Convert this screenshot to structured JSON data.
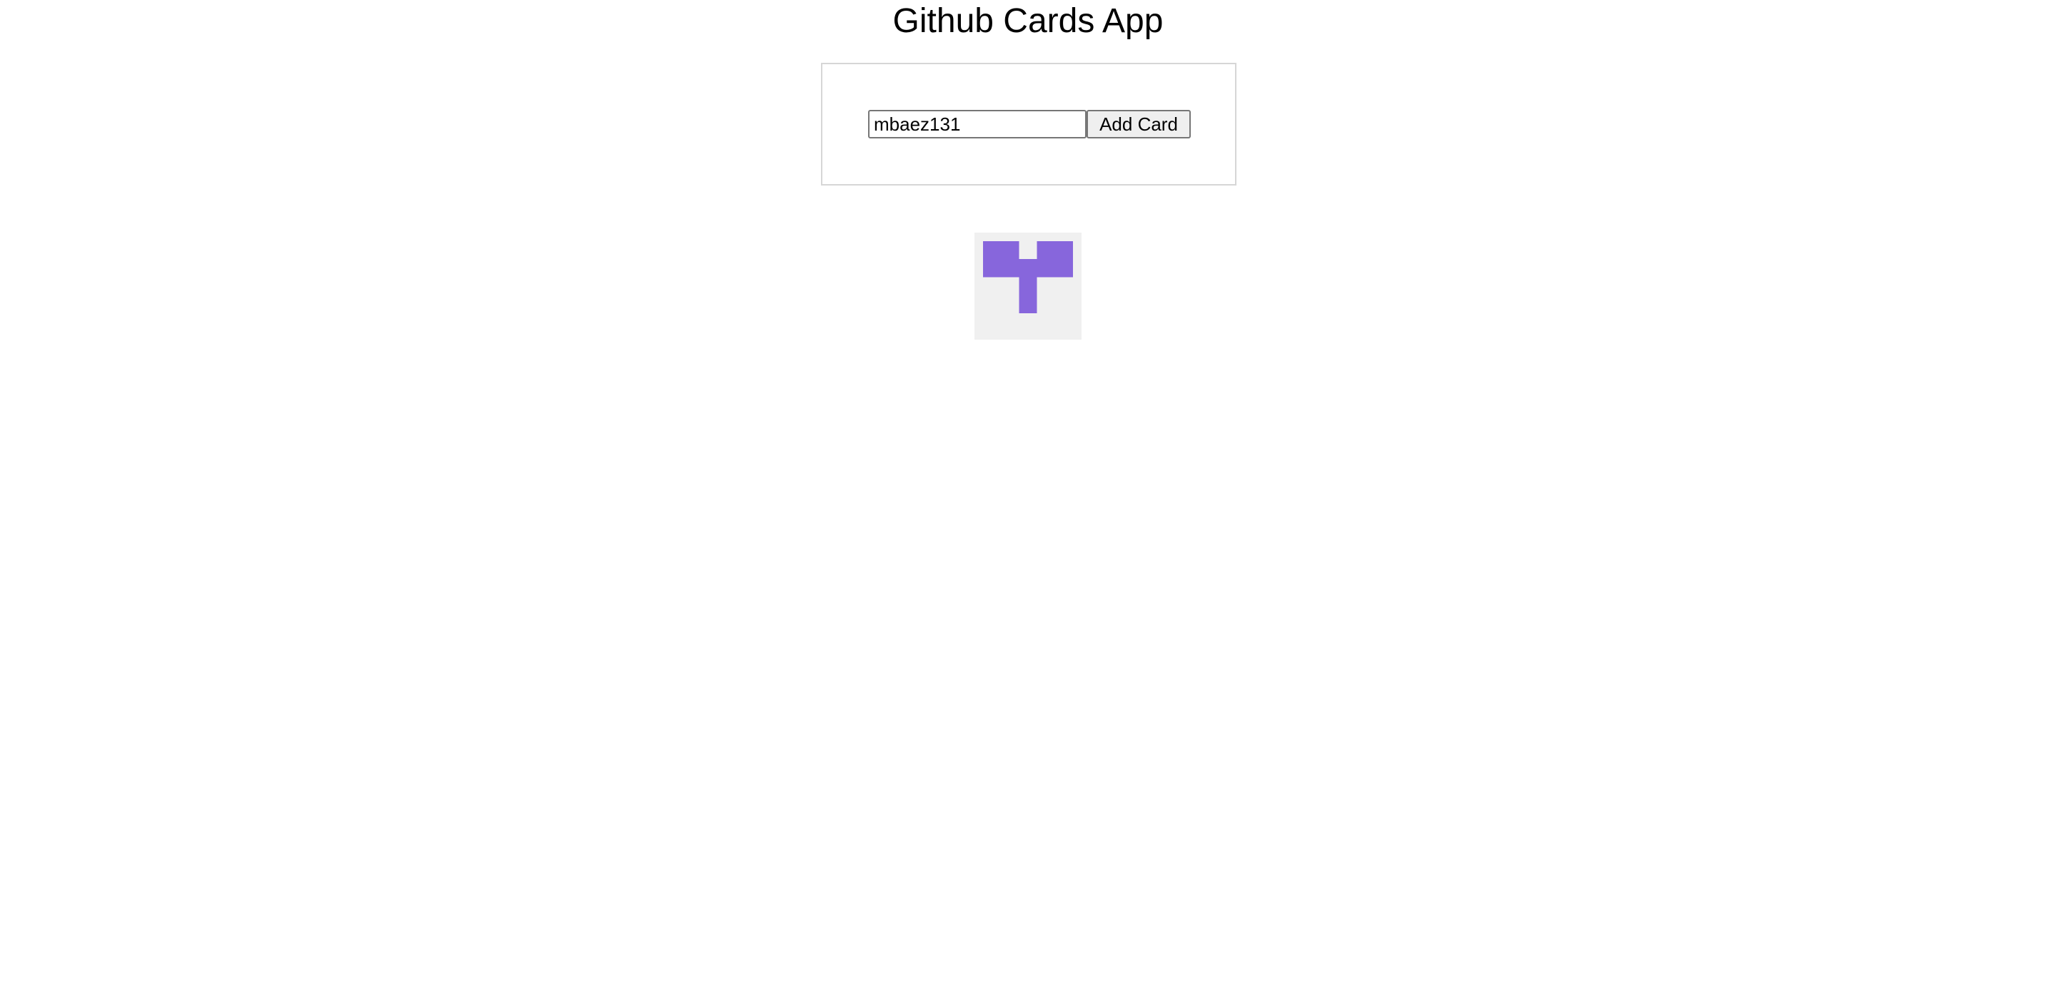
{
  "app": {
    "title": "Github Cards App"
  },
  "form": {
    "username_value": "mbaez131",
    "submit_label": "Add Card"
  },
  "cards": [
    {
      "avatar": "identicon-avatar",
      "avatar_color": "#8766dc",
      "avatar_background": "#f0f0f0"
    }
  ]
}
